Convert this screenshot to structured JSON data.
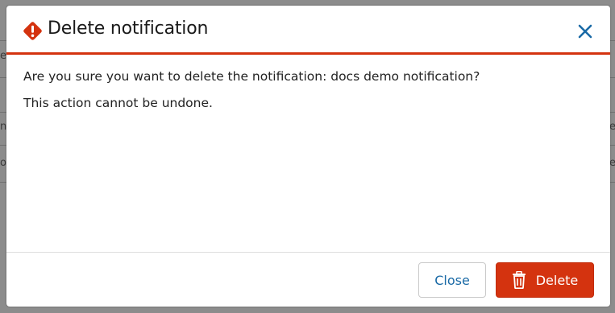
{
  "background": {
    "fragments": [
      "e",
      "n",
      "o",
      "e",
      "e"
    ]
  },
  "modal": {
    "title": "Delete notification",
    "header_icon": "warning-diamond-icon",
    "close_icon": "close-x-icon",
    "body": {
      "line1": "Are you sure you want to delete the notification: docs demo notification?",
      "line2": "This action cannot be undone."
    },
    "footer": {
      "close_label": "Close",
      "delete_label": "Delete",
      "delete_icon": "trash-icon"
    }
  },
  "colors": {
    "danger": "#d4330f",
    "link": "#1a6aa6"
  }
}
